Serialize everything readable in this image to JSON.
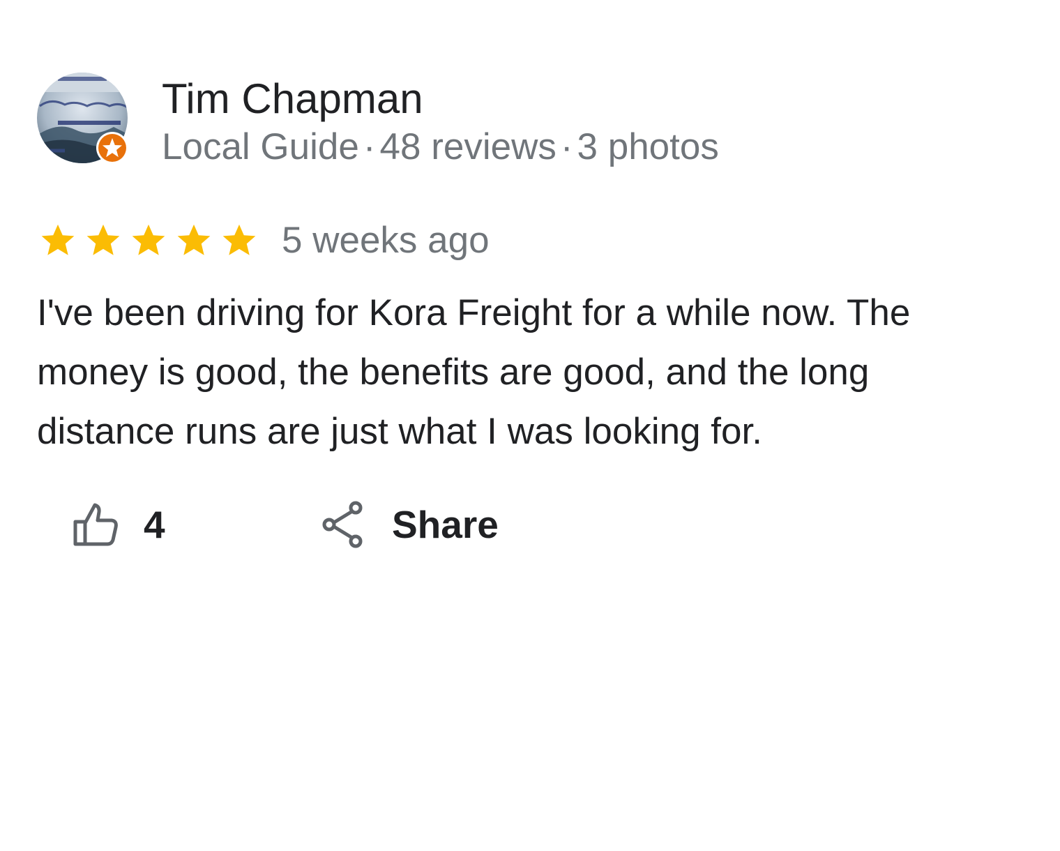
{
  "author": {
    "name": "Tim Chapman",
    "badge": "Local Guide",
    "reviews": "48 reviews",
    "photos": "3 photos",
    "separator": "·",
    "avatar_icon": "profile-photo-chicago-logo",
    "badge_icon": "local-guide-star-badge",
    "badge_color": "#e8710a"
  },
  "rating": {
    "stars": 5,
    "max_stars": 5,
    "star_color": "#fbbc04",
    "time_ago": "5 weeks ago"
  },
  "review": {
    "text": "I've been driving for Kora Freight for a while now. The money is good, the benefits are good, and the long distance runs are just what I was looking for."
  },
  "actions": {
    "like_icon": "thumbs-up-icon",
    "like_count": "4",
    "share_icon": "share-icon",
    "share_label": "Share"
  },
  "colors": {
    "primary_text": "#202124",
    "secondary_text": "#70757a",
    "icon": "#5f6368"
  }
}
